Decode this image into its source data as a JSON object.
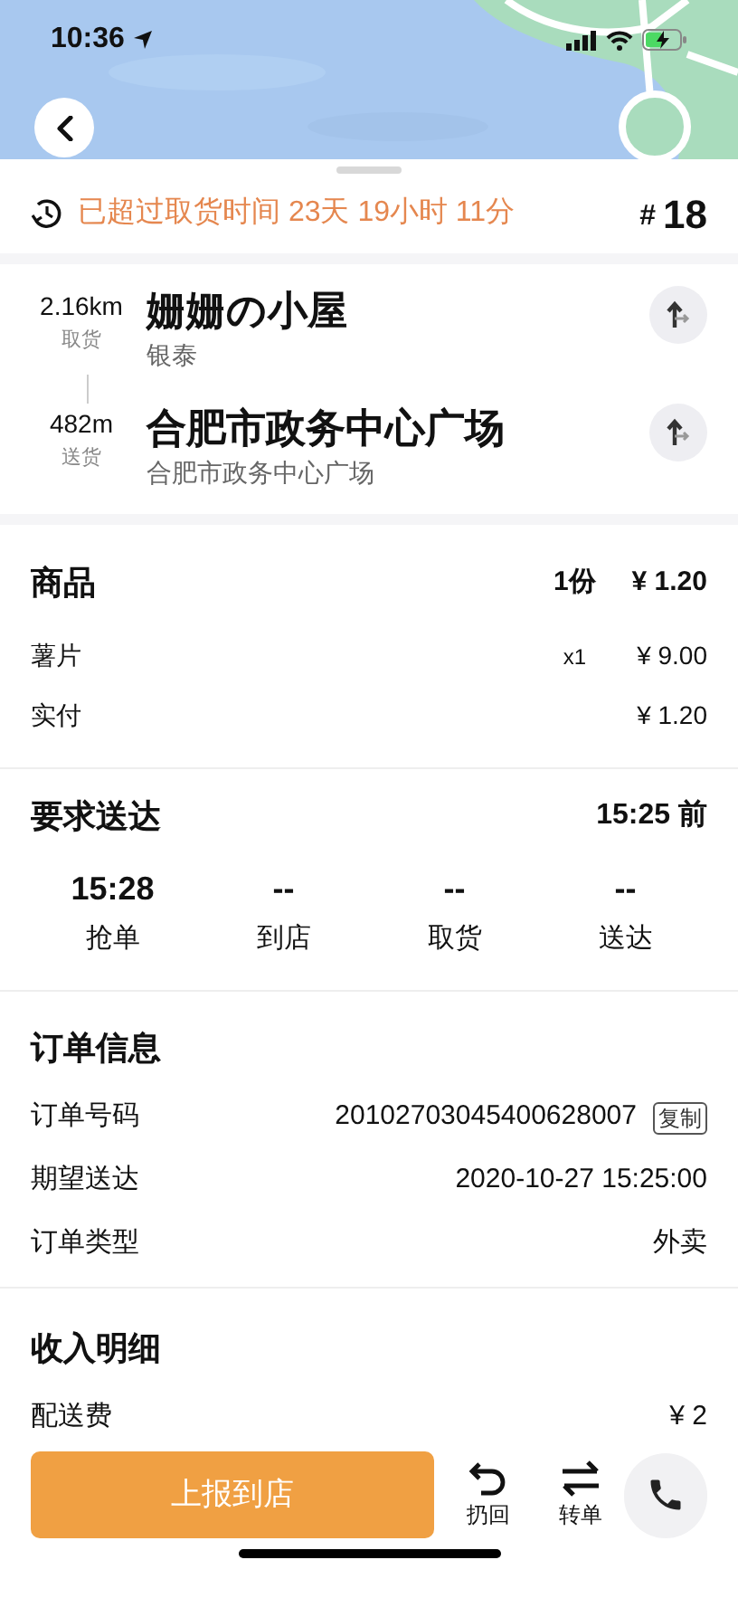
{
  "status_bar": {
    "time": "10:36"
  },
  "overdue": {
    "text": "已超过取货时间 23天 19小时 11分",
    "hash": "#",
    "number": "18"
  },
  "stops": [
    {
      "distance": "2.16km",
      "label": "取货",
      "name": "姗姗の小屋",
      "address": "银泰"
    },
    {
      "distance": "482m",
      "label": "送货",
      "name": "合肥市政务中心广场",
      "address": "合肥市政务中心广场"
    }
  ],
  "goods": {
    "title": "商品",
    "count": "1份",
    "total": "¥ 1.20",
    "items": [
      {
        "name": "薯片",
        "qty": "x1",
        "price": "¥ 9.00"
      },
      {
        "name": "实付",
        "price": "¥ 1.20"
      }
    ]
  },
  "delivery": {
    "title": "要求送达",
    "deadline": "15:25 前",
    "steps": [
      {
        "time": "15:28",
        "label": "抢单"
      },
      {
        "time": "--",
        "label": "到店"
      },
      {
        "time": "--",
        "label": "取货"
      },
      {
        "time": "--",
        "label": "送达"
      }
    ]
  },
  "order_info": {
    "title": "订单信息",
    "rows": [
      {
        "label": "订单号码",
        "value": "20102703045400628007",
        "action": "复制"
      },
      {
        "label": "期望送达",
        "value": "2020-10-27 15:25:00"
      },
      {
        "label": "订单类型",
        "value": "外卖"
      }
    ]
  },
  "income": {
    "title": "收入明细",
    "rows": [
      {
        "label": "配送费",
        "value": "¥ 2"
      }
    ]
  },
  "bottom_bar": {
    "primary": "上报到店",
    "actions": [
      {
        "kind": "undo",
        "label": "扔回"
      },
      {
        "kind": "transfer",
        "label": "转单"
      }
    ]
  }
}
